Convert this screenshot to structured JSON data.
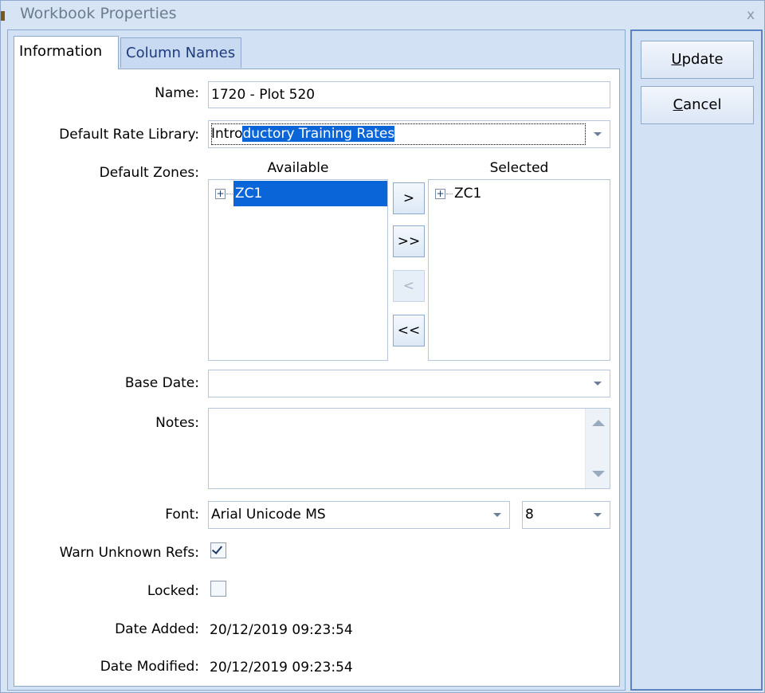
{
  "window": {
    "title": "Workbook Properties",
    "close_glyph": "x"
  },
  "tabs": [
    {
      "label": "Information",
      "active": true
    },
    {
      "label": "Column Names",
      "active": false
    }
  ],
  "form": {
    "name_label": "Name:",
    "name_value": "1720 - Plot 520",
    "rate_label": "Default Rate Library:",
    "rate_value_prefix": "Intro",
    "rate_value_selected": "ductory Training Rates",
    "zones_label": "Default Zones:",
    "available_header": "Available",
    "selected_header": "Selected",
    "available_items": [
      "ZC1"
    ],
    "selected_items": [
      "ZC1"
    ],
    "move_buttons": {
      "add": ">",
      "add_all": ">>",
      "remove": "<",
      "remove_all": "<<"
    },
    "base_date_label": "Base Date:",
    "base_date_value": "",
    "notes_label": "Notes:",
    "notes_value": "",
    "font_label": "Font:",
    "font_value": "Arial Unicode MS",
    "font_size_value": "8",
    "warn_label": "Warn Unknown Refs:",
    "warn_checked": true,
    "locked_label": "Locked:",
    "locked_checked": false,
    "date_added_label": "Date Added:",
    "date_added_value": "20/12/2019 09:23:54",
    "date_modified_label": "Date Modified:",
    "date_modified_value": "20/12/2019 09:23:54"
  },
  "actions": {
    "update_mnemonic": "U",
    "update_rest": "pdate",
    "cancel_mnemonic": "C",
    "cancel_rest": "ancel"
  },
  "colors": {
    "accent": "#0a66d8",
    "frame": "#8fa9cc",
    "window_bg": "#d7e4f4"
  }
}
